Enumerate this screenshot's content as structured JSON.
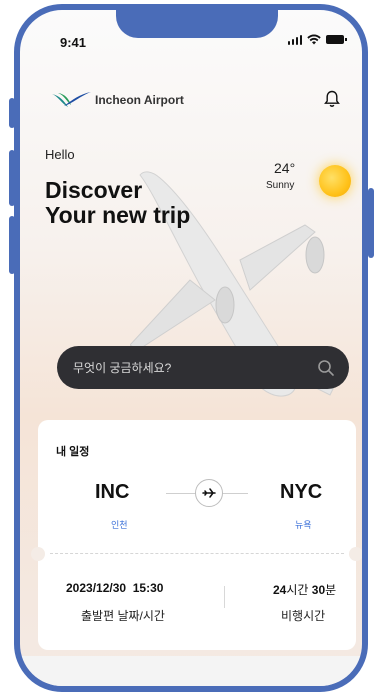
{
  "status_bar": {
    "time": "9:41"
  },
  "header": {
    "brand": "Incheon Airport"
  },
  "hero": {
    "greeting": "Hello",
    "headline_line1": "Discover",
    "headline_line2": "Your new trip",
    "temperature": "24°",
    "weather": "Sunny"
  },
  "search": {
    "placeholder": "무엇이 궁금하세요?"
  },
  "trip_card": {
    "title": "내 일정",
    "origin_code": "INC",
    "origin_city": "인천",
    "destination_code": "NYC",
    "destination_city": "뉴욕",
    "departure_datetime": "2023/12/30  15:30",
    "departure_label": "출발편 날짜/시간",
    "duration_hours": "24",
    "duration_hours_unit": "시간",
    "duration_minutes": "30",
    "duration_minutes_unit": "분",
    "duration_label": "비행시간"
  },
  "colors": {
    "frame": "#4a6cb8",
    "search_bg": "#2f2f33",
    "city_accent": "#3a6fd8",
    "sun": "#ffc21a"
  },
  "icons": [
    "signal-icon",
    "wifi-icon",
    "battery-icon",
    "logo-icon",
    "bell-icon",
    "search-icon",
    "airplane-icon"
  ]
}
